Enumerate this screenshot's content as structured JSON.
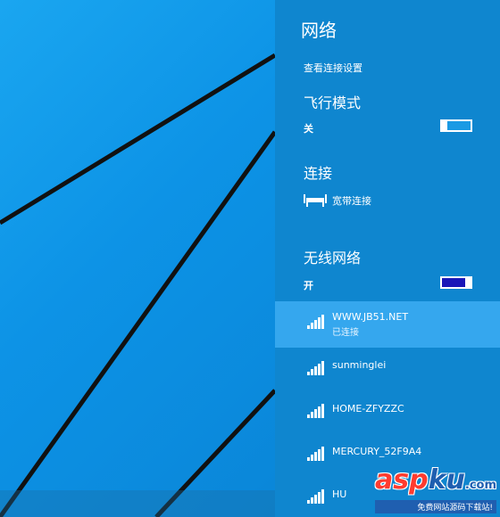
{
  "panel": {
    "title": "网络",
    "view_settings_link": "查看连接设置",
    "airplane": {
      "heading": "飞行模式",
      "state_label": "关",
      "is_on": false
    },
    "connections": {
      "heading": "连接",
      "broadband_label": "宽带连接"
    },
    "wifi": {
      "heading": "无线网络",
      "state_label": "开",
      "is_on": true,
      "networks": [
        {
          "name": "WWW.JB51.NET",
          "status": "已连接",
          "selected": true
        },
        {
          "name": "sunminglei",
          "status": "",
          "selected": false
        },
        {
          "name": "HOME-ZFYZZC",
          "status": "",
          "selected": false
        },
        {
          "name": "MERCURY_52F9A4",
          "status": "",
          "selected": false
        },
        {
          "name": "HU",
          "status": "",
          "selected": false
        }
      ]
    }
  },
  "colors": {
    "panel_bg": "#0f86cf",
    "selected_bg": "#35a7ee",
    "toggle_on": "#1a17b8",
    "toggle_off": "#1a9ae4"
  },
  "watermark": {
    "logo_a": "asp",
    "logo_b": "ku",
    "logo_com": ".com",
    "sub": "免费网站源码下载站!"
  }
}
